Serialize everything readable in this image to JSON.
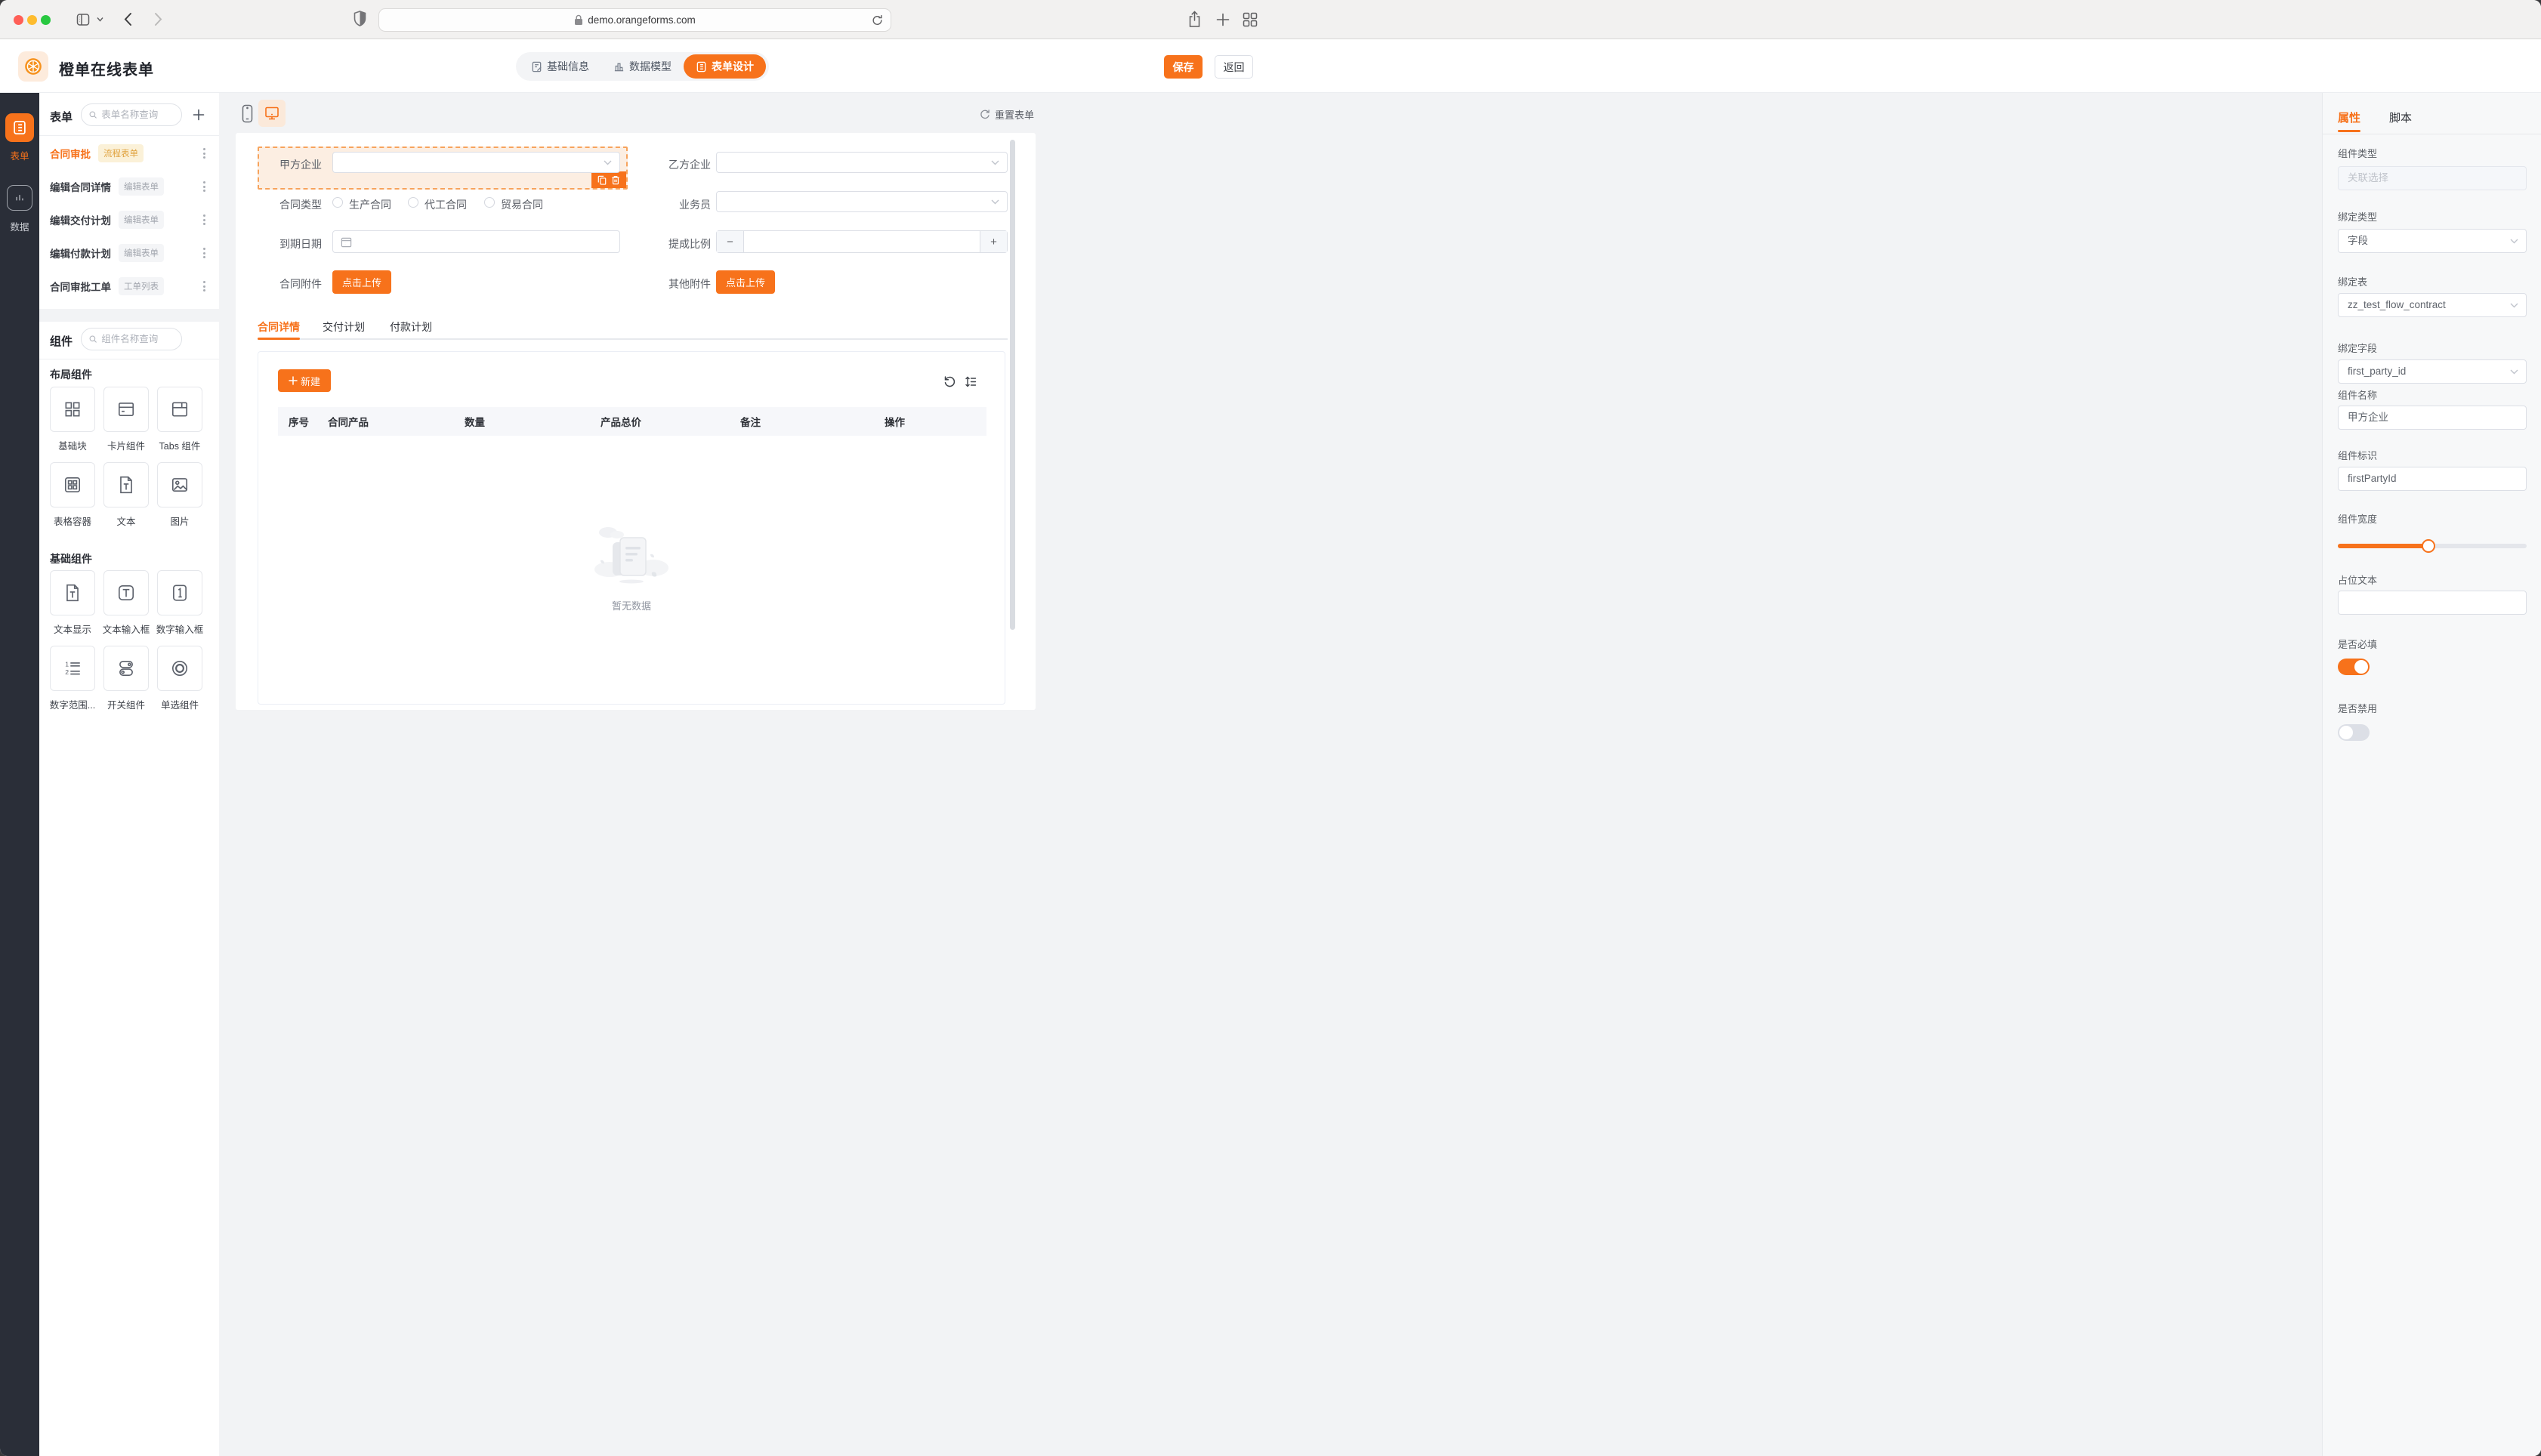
{
  "colors": {
    "accent": "#F7721B",
    "accent_light": "#FDEBDC",
    "selection_bg": "#FCEEE2",
    "badge_yellow_bg": "#FBF1D8",
    "badge_yellow_text": "#E0A23E",
    "rail_bg": "#2A2E38",
    "traffic_red": "#FF5F57",
    "traffic_yellow": "#FEBC2E",
    "traffic_green": "#28C840"
  },
  "icons": [
    "sidebar-icon",
    "chevron-down-icon",
    "back-icon",
    "forward-icon",
    "shield-icon",
    "lock-icon",
    "reload-icon",
    "share-icon",
    "new-tab-icon",
    "tabs-overview-icon",
    "orange-logo-icon",
    "doc-edit-icon",
    "bar-chart-icon",
    "list-icon",
    "search-icon",
    "plus-icon",
    "kebab-icon",
    "phone-icon",
    "monitor-icon",
    "refresh-icon",
    "select-chevron-icon",
    "calendar-icon",
    "copy-icon",
    "trash-icon",
    "reset-ccw-icon",
    "sort-icon",
    "empty-doc-illustration"
  ],
  "browser": {
    "url": "demo.orangeforms.com"
  },
  "app_header": {
    "title": "橙单在线表单",
    "nav": [
      {
        "label": "基础信息"
      },
      {
        "label": "数据模型"
      },
      {
        "label": "表单设计",
        "active": true
      }
    ],
    "save": "保存",
    "back": "返回"
  },
  "rail": {
    "items": [
      {
        "label": "表单",
        "active": true
      },
      {
        "label": "数据"
      }
    ]
  },
  "forms_panel": {
    "title": "表单",
    "search_placeholder": "表单名称查询",
    "items": [
      {
        "name": "合同审批",
        "badge": "流程表单",
        "highlight": true
      },
      {
        "name": "编辑合同详情",
        "badge": "编辑表单"
      },
      {
        "name": "编辑交付计划",
        "badge": "编辑表单"
      },
      {
        "name": "编辑付款计划",
        "badge": "编辑表单"
      },
      {
        "name": "合同审批工单",
        "badge": "工单列表"
      }
    ]
  },
  "components_panel": {
    "title": "组件",
    "search_placeholder": "组件名称查询",
    "groups": [
      {
        "label": "布局组件",
        "items": [
          {
            "label": "基础块"
          },
          {
            "label": "卡片组件"
          },
          {
            "label": "Tabs 组件"
          },
          {
            "label": "表格容器"
          },
          {
            "label": "文本"
          },
          {
            "label": "图片"
          }
        ]
      },
      {
        "label": "基础组件",
        "items": [
          {
            "label": "文本显示"
          },
          {
            "label": "文本输入框"
          },
          {
            "label": "数字输入框"
          },
          {
            "label": "数字范围..."
          },
          {
            "label": "开关组件"
          },
          {
            "label": "单选组件"
          }
        ]
      }
    ]
  },
  "canvas": {
    "reset": "重置表单",
    "fields": {
      "first_party": {
        "label": "甲方企业"
      },
      "second_party": {
        "label": "乙方企业"
      },
      "contract_type": {
        "label": "合同类型",
        "options": [
          "生产合同",
          "代工合同",
          "贸易合同"
        ]
      },
      "salesman": {
        "label": "业务员"
      },
      "due_date": {
        "label": "到期日期"
      },
      "commission": {
        "label": "提成比例",
        "minus": "−",
        "plus": "+"
      },
      "contract_attachment": {
        "label": "合同附件",
        "button": "点击上传"
      },
      "other_attachment": {
        "label": "其他附件",
        "button": "点击上传"
      }
    },
    "detail_tabs": [
      {
        "label": "合同详情",
        "active": true
      },
      {
        "label": "交付计划"
      },
      {
        "label": "付款计划"
      }
    ],
    "table": {
      "new_button": "新建",
      "columns": [
        "序号",
        "合同产品",
        "数量",
        "产品总价",
        "备注",
        "操作"
      ],
      "empty": "暂无数据"
    }
  },
  "props_panel": {
    "tabs": [
      {
        "label": "属性",
        "active": true
      },
      {
        "label": "脚本"
      }
    ],
    "fields": [
      {
        "label": "组件类型",
        "value": "关联选择",
        "type": "disabled"
      },
      {
        "label": "绑定类型",
        "value": "字段",
        "type": "select"
      },
      {
        "label": "绑定表",
        "value": "zz_test_flow_contract",
        "type": "select"
      },
      {
        "label": "绑定字段",
        "value": "first_party_id",
        "type": "select"
      },
      {
        "label": "组件名称",
        "value": "甲方企业",
        "type": "input"
      },
      {
        "label": "组件标识",
        "value": "firstPartyId",
        "type": "input"
      },
      {
        "label": "组件宽度",
        "type": "slider",
        "percent": 48
      },
      {
        "label": "占位文本",
        "value": "",
        "type": "input"
      },
      {
        "label": "是否必填",
        "type": "switch",
        "on": true
      },
      {
        "label": "是否禁用",
        "type": "switch",
        "on": false
      }
    ]
  }
}
